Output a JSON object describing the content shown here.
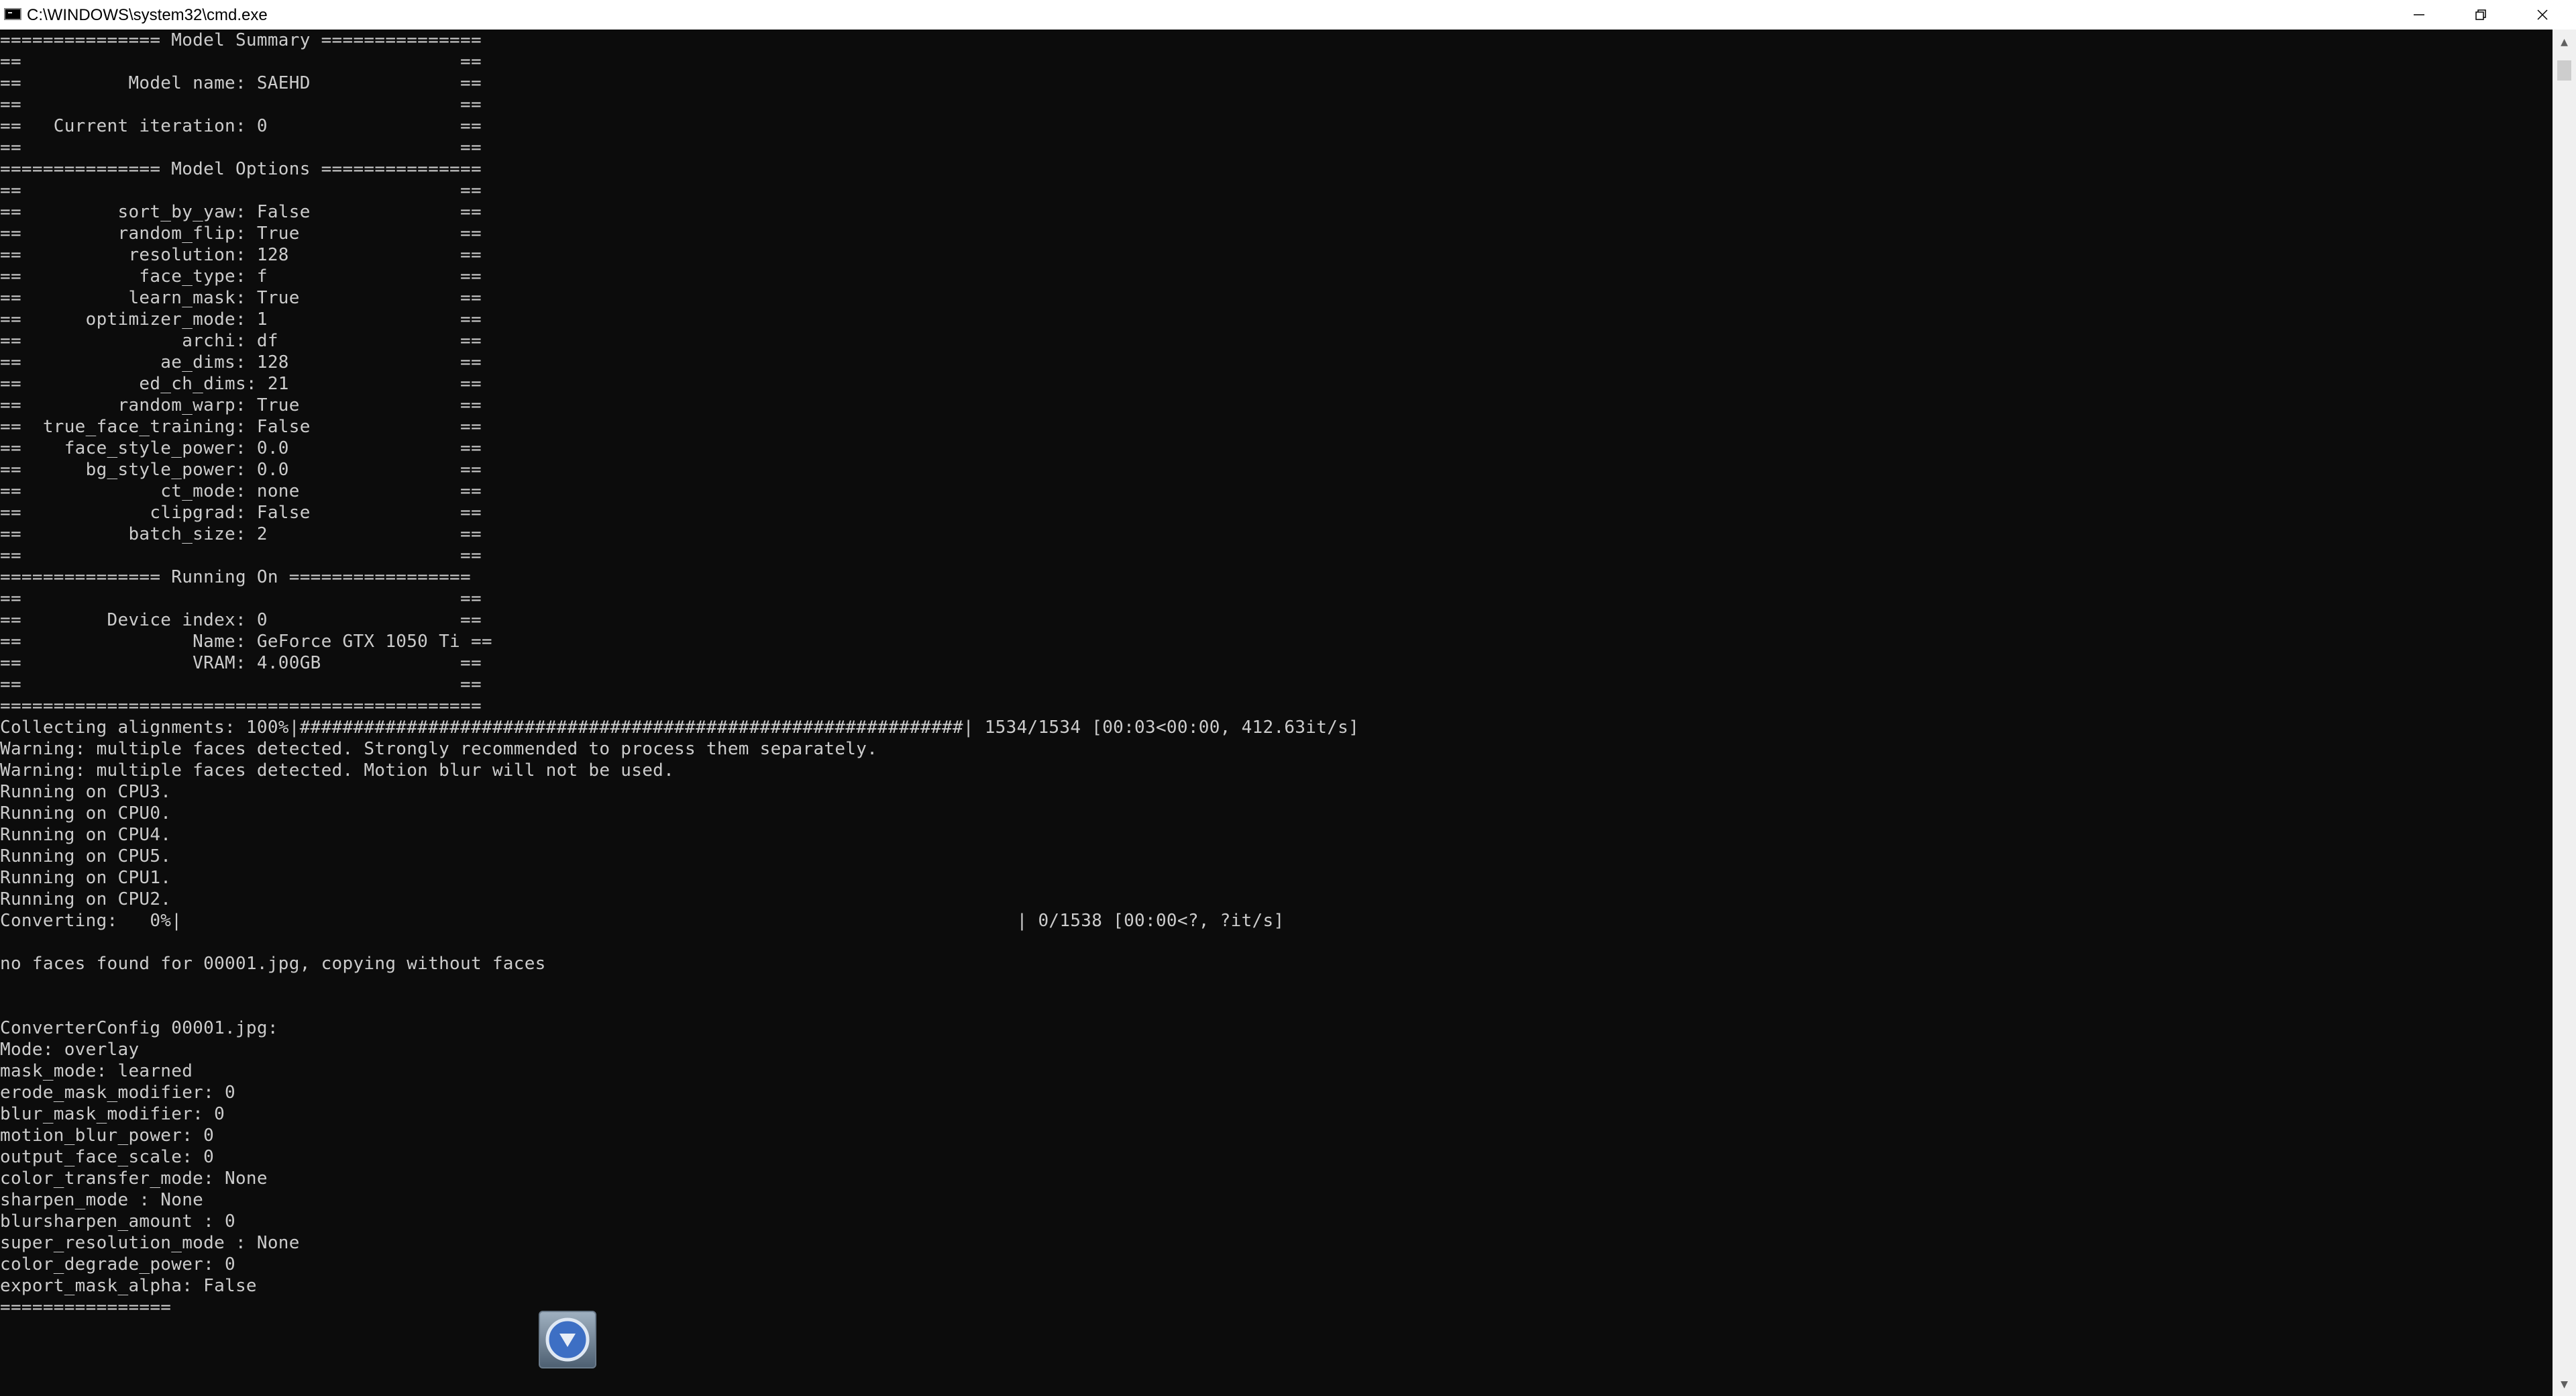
{
  "window": {
    "title": "C:\\WINDOWS\\system32\\cmd.exe",
    "app_icon": "cmd-icon",
    "controls": [
      "minimize-icon",
      "maximize-icon",
      "close-icon"
    ]
  },
  "console": {
    "lines": [
      "=============== Model Summary ===============",
      "==                                         ==",
      "==          Model name: SAEHD              ==",
      "==                                         ==",
      "==   Current iteration: 0                  ==",
      "==                                         ==",
      "=============== Model Options ===============",
      "==                                         ==",
      "==         sort_by_yaw: False              ==",
      "==         random_flip: True               ==",
      "==          resolution: 128                ==",
      "==           face_type: f                  ==",
      "==          learn_mask: True               ==",
      "==      optimizer_mode: 1                  ==",
      "==               archi: df                 ==",
      "==             ae_dims: 128                ==",
      "==           ed_ch_dims: 21                ==",
      "==         random_warp: True               ==",
      "==  true_face_training: False              ==",
      "==    face_style_power: 0.0                ==",
      "==      bg_style_power: 0.0                ==",
      "==             ct_mode: none               ==",
      "==            clipgrad: False              ==",
      "==          batch_size: 2                  ==",
      "==                                         ==",
      "=============== Running On =================",
      "==                                         ==",
      "==        Device index: 0                  ==",
      "==                Name: GeForce GTX 1050 Ti ==",
      "==                VRAM: 4.00GB             ==",
      "==                                         ==",
      "=============================================",
      "Collecting alignments: 100%|##############################################################| 1534/1534 [00:03<00:00, 412.63it/s]",
      "Warning: multiple faces detected. Strongly recommended to process them separately.",
      "Warning: multiple faces detected. Motion blur will not be used.",
      "Running on CPU3.",
      "Running on CPU0.",
      "Running on CPU4.",
      "Running on CPU5.",
      "Running on CPU1.",
      "Running on CPU2.",
      "Converting:   0%|                                                                              | 0/1538 [00:00<?, ?it/s]",
      "",
      "no faces found for 00001.jpg, copying without faces",
      "",
      "",
      "ConverterConfig 00001.jpg:",
      "Mode: overlay",
      "mask_mode: learned",
      "erode_mask_modifier: 0",
      "blur_mask_modifier: 0",
      "motion_blur_power: 0",
      "output_face_scale: 0",
      "color_transfer_mode: None",
      "sharpen_mode : None",
      "blursharpen_amount : 0",
      "super_resolution_mode : None",
      "color_degrade_power: 0",
      "export_mask_alpha: False",
      "================"
    ]
  },
  "scrollbar": {
    "up_icon": "scroll-up-arrow-icon",
    "down_icon": "scroll-down-arrow-icon"
  },
  "overlay_button": {
    "icon": "download-arrow-icon"
  },
  "colors": {
    "console_bg": "#0c0c0c",
    "console_text": "#cccccc",
    "titlebar_bg": "#ffffff"
  }
}
